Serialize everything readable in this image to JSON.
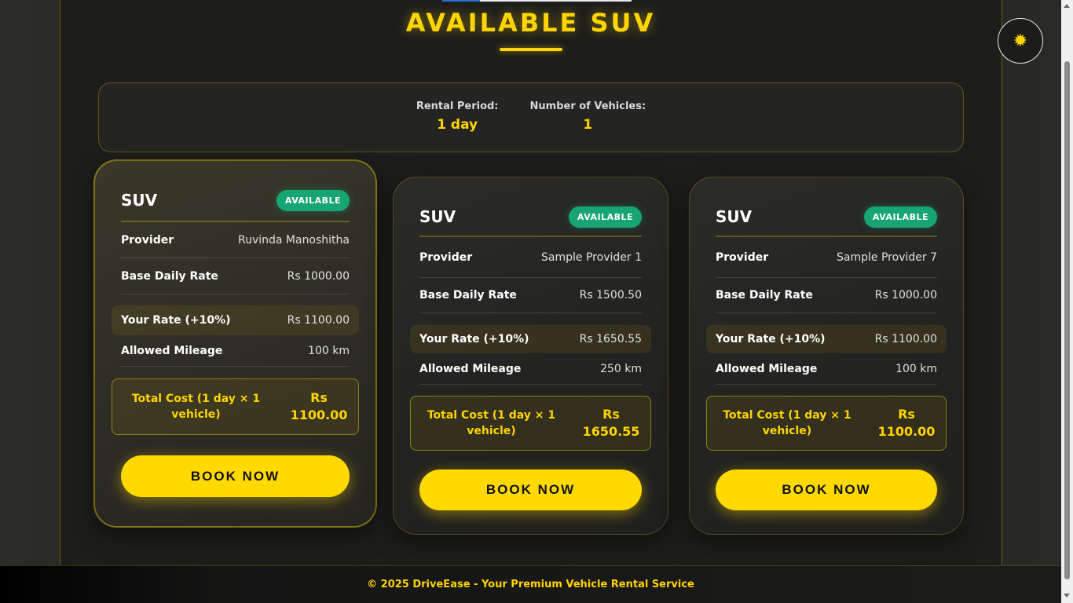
{
  "header": {
    "title": "AVAILABLE SUV",
    "theme_toggle_icon": "sun-icon"
  },
  "summary": {
    "rental_period_label": "Rental Period:",
    "rental_period_value": "1 day",
    "vehicles_label": "Number of Vehicles:",
    "vehicles_value": "1"
  },
  "cards": [
    {
      "type": "SUV",
      "status": "AVAILABLE",
      "provider_label": "Provider",
      "provider": "Ruvinda Manoshitha",
      "base_rate_label": "Base Daily Rate",
      "base_rate": "Rs 1000.00",
      "your_rate_label": "Your Rate (+10%)",
      "your_rate": "Rs 1100.00",
      "mileage_label": "Allowed Mileage",
      "mileage": "100 km",
      "total_label": "Total Cost (1 day × 1 vehicle)",
      "total_currency": "Rs",
      "total_value": "1100.00",
      "book_label": "BOOK NOW"
    },
    {
      "type": "SUV",
      "status": "AVAILABLE",
      "provider_label": "Provider",
      "provider": "Sample Provider 1",
      "base_rate_label": "Base Daily Rate",
      "base_rate": "Rs 1500.50",
      "your_rate_label": "Your Rate (+10%)",
      "your_rate": "Rs 1650.55",
      "mileage_label": "Allowed Mileage",
      "mileage": "250 km",
      "total_label": "Total Cost (1 day × 1 vehicle)",
      "total_currency": "Rs",
      "total_value": "1650.55",
      "book_label": "BOOK NOW"
    },
    {
      "type": "SUV",
      "status": "AVAILABLE",
      "provider_label": "Provider",
      "provider": "Sample Provider 7",
      "base_rate_label": "Base Daily Rate",
      "base_rate": "Rs 1000.00",
      "your_rate_label": "Your Rate (+10%)",
      "your_rate": "Rs 1100.00",
      "mileage_label": "Allowed Mileage",
      "mileage": "100 km",
      "total_label": "Total Cost (1 day × 1 vehicle)",
      "total_currency": "Rs",
      "total_value": "1100.00",
      "book_label": "BOOK NOW"
    }
  ],
  "footer": {
    "text": "© 2025 DriveEase - Your Premium Vehicle Rental Service"
  },
  "colors": {
    "accent": "#ffd400",
    "status": "#17a673",
    "background": "#1d1d1b"
  }
}
